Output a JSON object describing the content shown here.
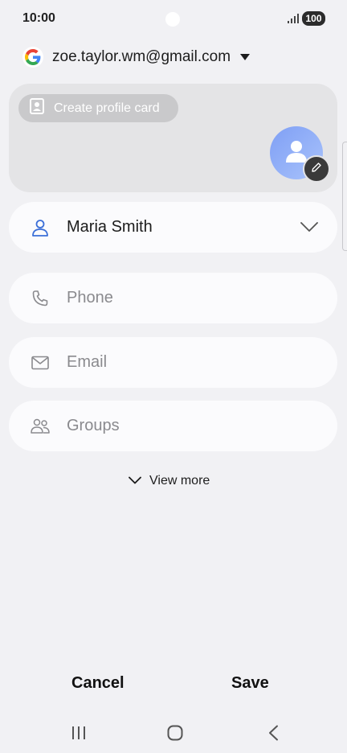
{
  "status_bar": {
    "time": "10:00",
    "battery": "100"
  },
  "account": {
    "email": "zoe.taylor.wm@gmail.com",
    "logo_icon": "google-logo-icon"
  },
  "profile_card": {
    "create_label": "Create profile card",
    "create_icon": "profile-card-icon",
    "avatar_icon": "person-icon",
    "edit_icon": "pencil-icon"
  },
  "fields": {
    "name": {
      "value": "Maria Smith",
      "icon": "person-outline-icon"
    },
    "phone": {
      "placeholder": "Phone",
      "icon": "phone-icon"
    },
    "email": {
      "placeholder": "Email",
      "icon": "mail-icon"
    },
    "groups": {
      "placeholder": "Groups",
      "icon": "groups-icon"
    }
  },
  "view_more": {
    "label": "View more"
  },
  "actions": {
    "cancel": "Cancel",
    "save": "Save"
  },
  "nav": {
    "recents_icon": "recents-icon",
    "home_icon": "home-icon",
    "back_icon": "back-icon"
  },
  "colors": {
    "background": "#f1f1f4",
    "field_bg": "#fbfbfd",
    "accent_blue": "#3b6fd8",
    "avatar_blue": "#8aa8f7"
  }
}
